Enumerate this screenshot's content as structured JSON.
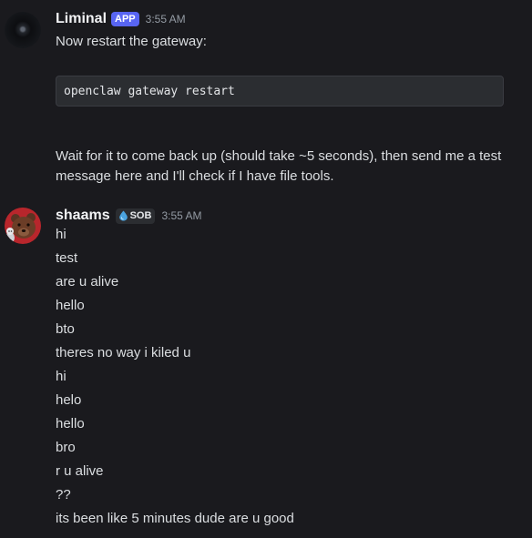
{
  "messages": [
    {
      "author": "Liminal",
      "app_tag": "APP",
      "timestamp": "3:55 AM",
      "intro": "Now restart the gateway:",
      "code": "openclaw gateway restart",
      "followup": "Wait for it to come back up (should take ~5 seconds), then send me a test message here and I'll check if I have file tools.",
      "avatar_icon": "dark-circle-avatar"
    },
    {
      "author": "shaams",
      "role_tag": "SOB",
      "role_icon": "water-drop-icon",
      "timestamp": "3:55 AM",
      "avatar_icon": "bear-avatar",
      "lines": [
        "hi",
        "test",
        "are u alive",
        "hello",
        "bto",
        "theres no way i kiled u",
        "hi",
        "helo",
        "hello",
        "bro",
        "r u alive",
        "??",
        "its been like 5 minutes dude are u good"
      ]
    }
  ],
  "colors": {
    "background": "#1a1a1e",
    "app_tag": "#5865f2",
    "code_bg": "#2b2d31",
    "timestamp": "#949ba4",
    "avatar_red": "#b8262c"
  }
}
